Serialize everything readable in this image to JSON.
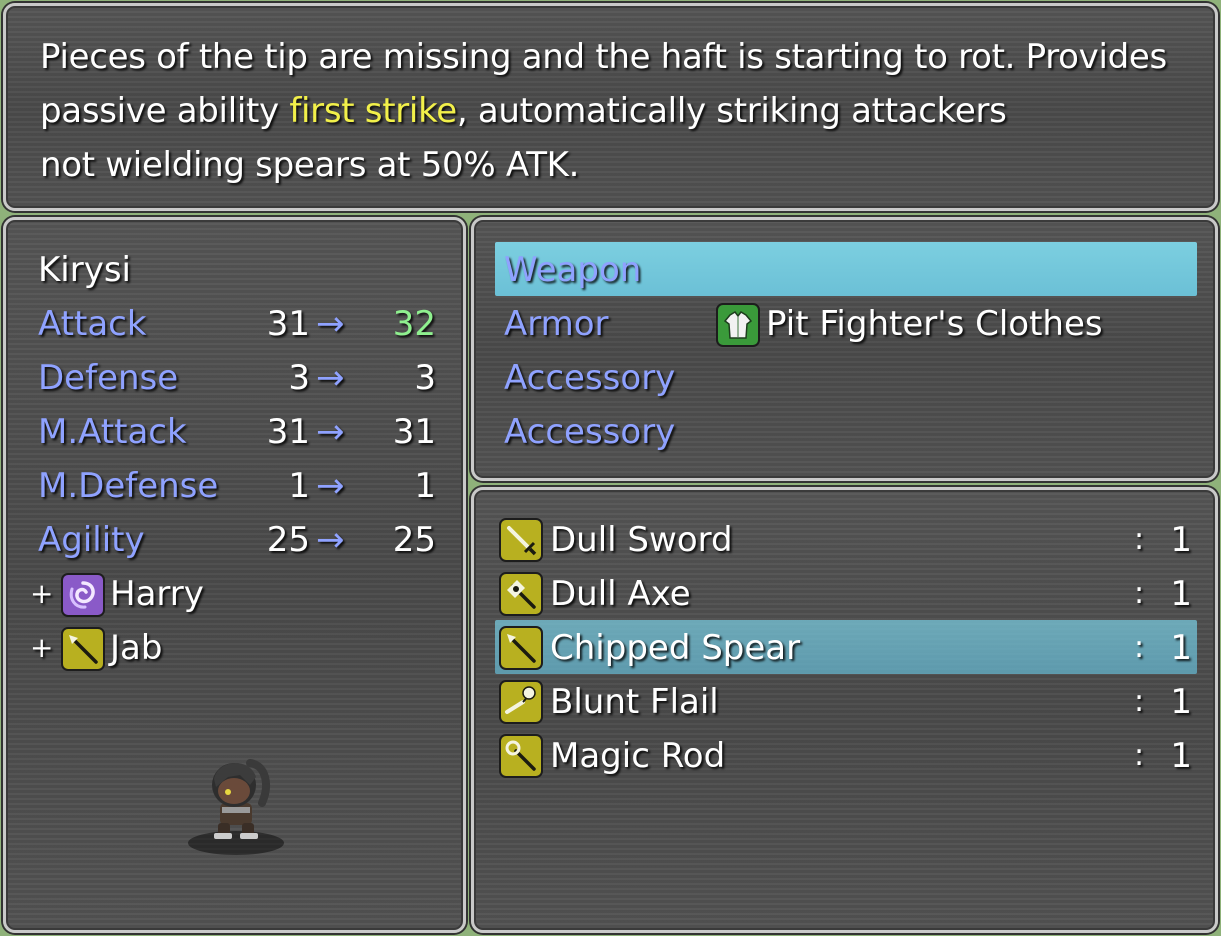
{
  "help": {
    "line1": "Pieces of the tip are missing and the haft is starting to rot. Provides",
    "line2_pre": "passive ability ",
    "line2_highlight": "first strike",
    "line2_post": ", automatically striking attackers",
    "line3": "not wielding spears at 50% ATK."
  },
  "status": {
    "actor_name": "Kirysi",
    "arrow": "→",
    "params": [
      {
        "label": "Attack",
        "current": "31",
        "new": "32",
        "increased": true
      },
      {
        "label": "Defense",
        "current": "3",
        "new": "3",
        "increased": false
      },
      {
        "label": "M.Attack",
        "current": "31",
        "new": "31",
        "increased": false
      },
      {
        "label": "M.Defense",
        "current": "1",
        "new": "1",
        "increased": false
      },
      {
        "label": "Agility",
        "current": "25",
        "new": "25",
        "increased": false
      }
    ],
    "skills": [
      {
        "prefix": "+",
        "icon": "vortex-icon",
        "name": "Harry"
      },
      {
        "prefix": "+",
        "icon": "spear-icon",
        "name": "Jab"
      }
    ],
    "character_sprite": "armored-warrior-sprite"
  },
  "slots": [
    {
      "label": "Weapon",
      "item": "",
      "icon": "",
      "selected": true
    },
    {
      "label": "Armor",
      "item": "Pit Fighter's Clothes",
      "icon": "clothes-icon",
      "selected": false
    },
    {
      "label": "Accessory",
      "item": "",
      "icon": "",
      "selected": false
    },
    {
      "label": "Accessory",
      "item": "",
      "icon": "",
      "selected": false
    }
  ],
  "items": [
    {
      "name": "Dull Sword",
      "icon": "sword-icon",
      "colon": ":",
      "qty": "1",
      "selected": false
    },
    {
      "name": "Dull Axe",
      "icon": "axe-icon",
      "colon": ":",
      "qty": "1",
      "selected": false
    },
    {
      "name": "Chipped Spear",
      "icon": "spear-icon",
      "colon": ":",
      "qty": "1",
      "selected": true
    },
    {
      "name": "Blunt Flail",
      "icon": "flail-icon",
      "colon": ":",
      "qty": "1",
      "selected": false
    },
    {
      "name": "Magic Rod",
      "icon": "rod-icon",
      "colon": ":",
      "qty": "1",
      "selected": false
    }
  ],
  "colors": {
    "system_blue": "#8fa2ff",
    "highlight_yellow": "#f2f04a",
    "increase_green": "#8ff08f",
    "cursor_cyan": "#75c9dd",
    "weapon_icon_bg": "#b8b020",
    "armor_icon_bg": "#3a9a3a",
    "skill_icon_bg": "#8a5ac8"
  }
}
